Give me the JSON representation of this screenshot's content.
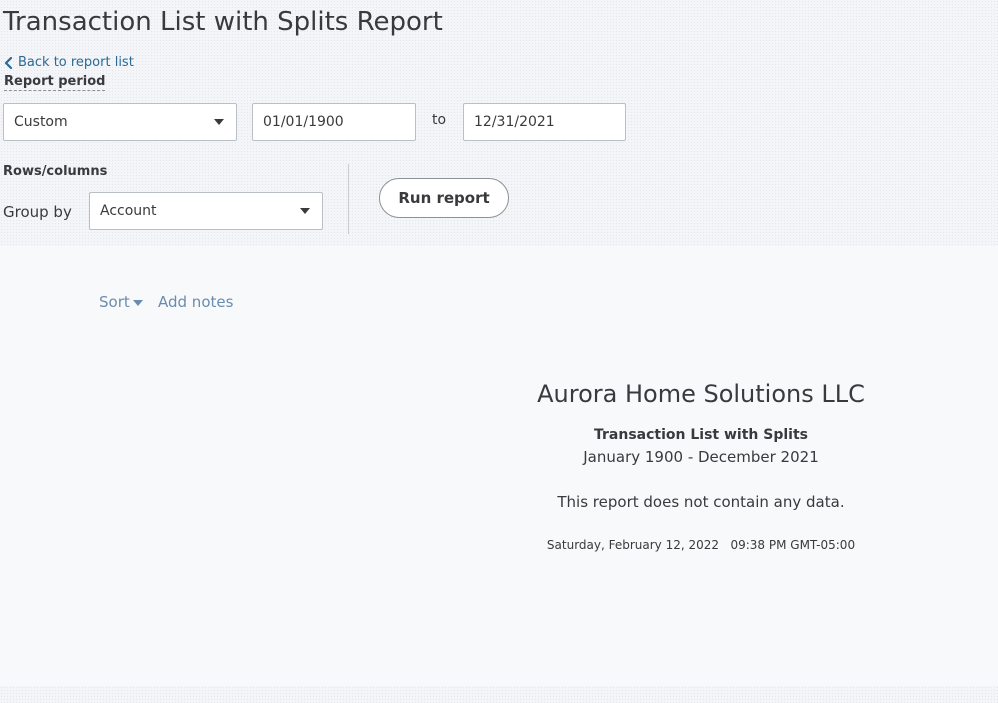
{
  "page": {
    "title": "Transaction List with Splits Report",
    "back_link": "Back to report list"
  },
  "filters": {
    "report_period_label": "Report period",
    "period_selected": "Custom",
    "date_from": "01/01/1900",
    "date_to": "12/31/2021",
    "to_label": "to",
    "rows_columns_label": "Rows/columns",
    "group_by_label": "Group by",
    "group_by_selected": "Account",
    "run_report_label": "Run report"
  },
  "toolbar": {
    "sort_label": "Sort",
    "add_notes_label": "Add notes"
  },
  "report": {
    "company_name": "Aurora Home Solutions LLC",
    "report_name": "Transaction List with Splits",
    "date_range": "January 1900 - December 2021",
    "empty_message": "This report does not contain any data.",
    "generated_at": "Saturday, February 12, 2022   09:38 PM GMT-05:00"
  },
  "icons": {
    "back": "chevron-left-icon",
    "dropdown": "caret-down-icon"
  },
  "colors": {
    "link": "#2b6a96",
    "toolbar_link": "#6b8cae",
    "text": "#393a3d"
  }
}
